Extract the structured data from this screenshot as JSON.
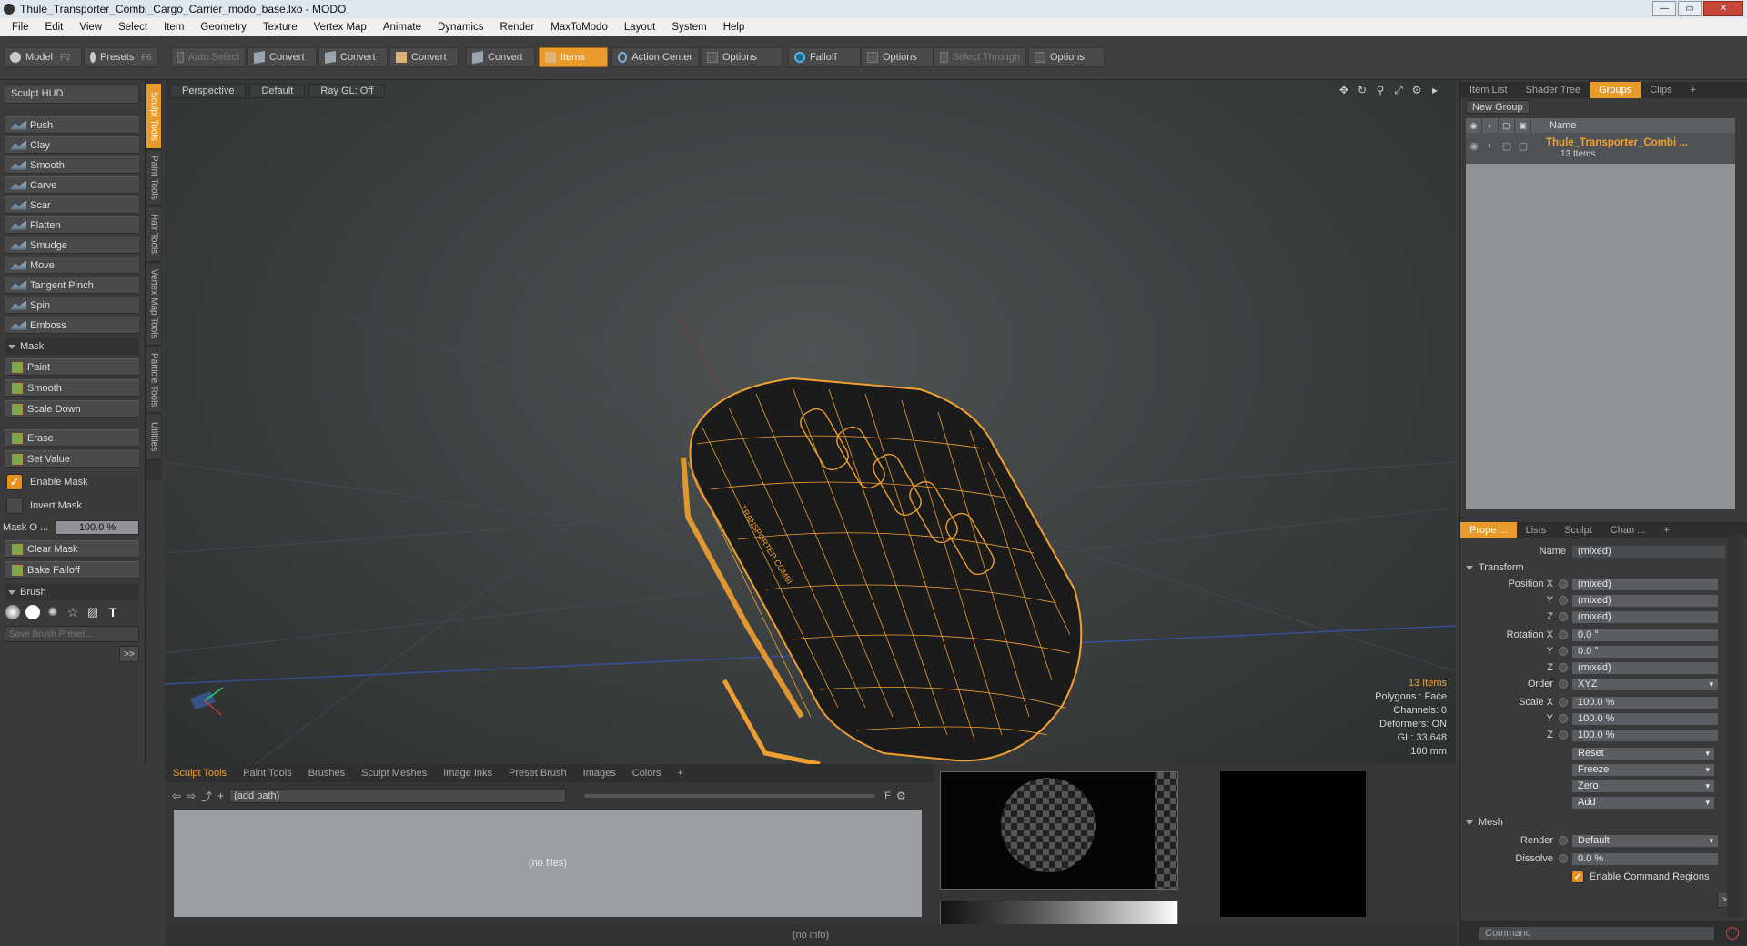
{
  "window": {
    "title": "Thule_Transporter_Combi_Cargo_Carrier_modo_base.lxo - MODO"
  },
  "menu": [
    "File",
    "Edit",
    "View",
    "Select",
    "Item",
    "Geometry",
    "Texture",
    "Vertex Map",
    "Animate",
    "Dynamics",
    "Render",
    "MaxToModo",
    "Layout",
    "System",
    "Help"
  ],
  "toolbar": {
    "model": "Model",
    "model_key": "F2",
    "presets": "Presets",
    "presets_key": "F6",
    "auto_select": "Auto Select",
    "convert1": "Convert",
    "convert2": "Convert",
    "convert3": "Convert",
    "convert4": "Convert",
    "items": "Items",
    "action_center": "Action Center",
    "options1": "Options",
    "falloff": "Falloff",
    "options2": "Options",
    "select_through": "Select Through",
    "options3": "Options"
  },
  "left": {
    "sculpt_hud": "Sculpt HUD",
    "brushes": [
      "Push",
      "Clay",
      "Smooth",
      "Carve",
      "Scar",
      "Flatten",
      "Smudge",
      "Move",
      "Tangent Pinch",
      "Spin",
      "Emboss"
    ],
    "mask_section": "Mask",
    "mask_tools": [
      "Paint",
      "Smooth",
      "Scale Down"
    ],
    "mask_tools2": [
      "Erase",
      "Set Value"
    ],
    "enable_mask": "Enable Mask",
    "invert_mask": "Invert Mask",
    "mask_opacity_label": "Mask O ...",
    "mask_opacity_value": "100.0 %",
    "clear_mask": "Clear Mask",
    "bake_falloff": "Bake Falloff",
    "brush_section": "Brush",
    "save_preset": "Save Brush Preset...",
    "more": ">>",
    "sidetabs": [
      "Sculpt Tools",
      "Paint Tools",
      "Hair Tools",
      "Vertex Map Tools",
      "Particle Tools",
      "Utilities"
    ]
  },
  "viewport": {
    "tab_view": "Perspective",
    "tab_style": "Default",
    "tab_raygl": "Ray GL: Off",
    "info": {
      "items": "13 Items",
      "polygons": "Polygons : Face",
      "channels": "Channels: 0",
      "deformers": "Deformers: ON",
      "gl": "GL: 33,648",
      "scale": "100 mm"
    },
    "label_text": "TRANSPORTER COMBI"
  },
  "bottom": {
    "tabs": [
      "Sculpt Tools",
      "Paint Tools",
      "Brushes",
      "Sculpt Meshes",
      "Image Inks",
      "Preset Brush",
      "Images",
      "Colors",
      "+"
    ],
    "path": "(add path)",
    "no_files": "(no files)",
    "status": "(no info)"
  },
  "right": {
    "top_tabs": [
      "Item List",
      "Shader Tree",
      "Groups",
      "Clips",
      "+"
    ],
    "new_group": "New Group",
    "col_name": "Name",
    "group_name": "Thule_Transporter_Combi ...",
    "group_count": "13 Items",
    "prop_tabs": [
      "Prope ...",
      "Lists",
      "Sculpt",
      "Chan ...",
      "+"
    ],
    "name_label": "Name",
    "name_value": "(mixed)",
    "transform_section": "Transform",
    "position_x_label": "Position X",
    "position_x": "(mixed)",
    "position_y_label": "Y",
    "position_y": "(mixed)",
    "position_z_label": "Z",
    "position_z": "(mixed)",
    "rotation_x_label": "Rotation X",
    "rotation_x": "0.0 °",
    "rotation_y_label": "Y",
    "rotation_y": "0.0 °",
    "rotation_z_label": "Z",
    "rotation_z": "(mixed)",
    "order_label": "Order",
    "order": "XYZ",
    "scale_x_label": "Scale X",
    "scale_x": "100.0 %",
    "scale_y_label": "Y",
    "scale_y": "100.0 %",
    "scale_z_label": "Z",
    "scale_z": "100.0 %",
    "reset": "Reset",
    "freeze": "Freeze",
    "zero": "Zero",
    "add": "Add",
    "mesh_section": "Mesh",
    "render_label": "Render",
    "render": "Default",
    "dissolve_label": "Dissolve",
    "dissolve": "0.0 %",
    "enable_regions": "Enable Command Regions",
    "more": ">>",
    "command_placeholder": "Command"
  },
  "colors": {
    "accent": "#e89a2a",
    "wire": "#f0a030"
  }
}
